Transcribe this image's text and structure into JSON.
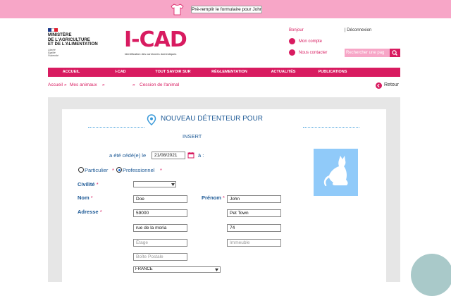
{
  "extension": {
    "button_label": "Pré-remplir le formulaire pour John Doe",
    "icon": "tshirt-icon"
  },
  "gov": {
    "lines": [
      "MINISTÈRE",
      "DE L'AGRICULTURE",
      "ET DE L'ALIMENTATION"
    ],
    "motto": [
      "Liberté",
      "Égalité",
      "Fraternité"
    ]
  },
  "brand": {
    "name": "I-CAD",
    "tagline": "Identification des carnivores domestiques",
    "color": "#d81b60"
  },
  "user_menu": {
    "greeting": "Bonjour",
    "logout": "| Déconnexion",
    "account": "Mon compte",
    "contact": "Nous contacter",
    "search_placeholder": "Rechercher une pag"
  },
  "nav": [
    "ACCUEIL",
    "I-CAD",
    "TOUT SAVOIR SUR",
    "RÉGLEMENTATION",
    "ACTUALITÉS",
    "PUBLICATIONS"
  ],
  "breadcrumb": {
    "home": "Accueil",
    "sep": "»",
    "animals": "Mes animaux",
    "current": "Cession de l'animal"
  },
  "back_label": "Retour",
  "form": {
    "title": "NOUVEAU DÉTENTEUR POUR",
    "subtitle": "INSERT",
    "ceded_label": "a été cédé(e) le",
    "ceded_date": "21/08/2021",
    "ceded_to": "à :",
    "radio_particulier": "Particulier",
    "radio_professionnel": "Professionnel",
    "star": "*",
    "civilite_label": "Civilité",
    "civilite_value": "",
    "nom_label": "Nom",
    "nom_value": "Doe",
    "prenom_label": "Prénom",
    "prenom_value": "John",
    "adresse_label": "Adresse",
    "postal_code": "59000",
    "city": "Pet Town",
    "street": "rue de la moria",
    "number": "74",
    "etage_placeholder": "Étage",
    "immeuble_placeholder": "Immeuble",
    "boite_placeholder": "Boîte Postale",
    "country": "FRANCE"
  },
  "colors": {
    "accent": "#d81b60",
    "title_blue": "#1e5a96",
    "topbar_pink": "#f7a6c7",
    "photo_blue": "#90caf9"
  }
}
